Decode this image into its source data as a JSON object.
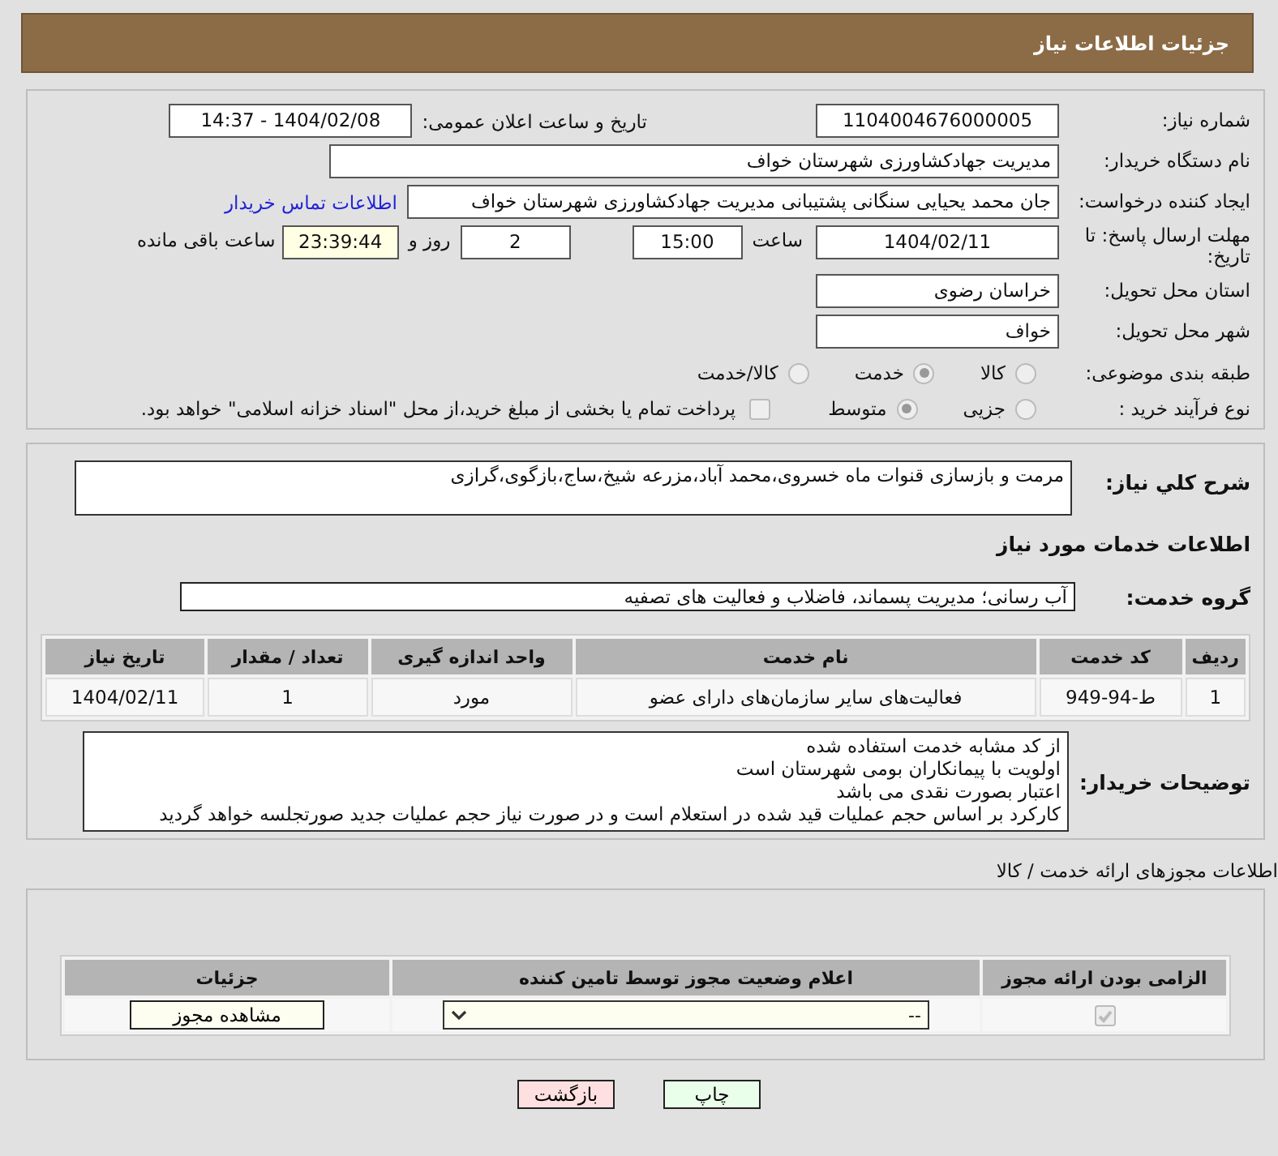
{
  "header": {
    "title": "جزئیات اطلاعات نیاز"
  },
  "details": {
    "need_number": {
      "label": "شماره نیاز:",
      "value": "1104004676000005"
    },
    "announce": {
      "label": "تاریخ و ساعت اعلان عمومی:",
      "value": "1404/02/08 - 14:37"
    },
    "buyer": {
      "label": "نام دستگاه خریدار:",
      "value": "مدیریت جهادکشاورزی شهرستان خواف"
    },
    "creator": {
      "label": "ایجاد کننده درخواست:",
      "value": "جان محمد یحیایی سنگانی پشتیبانی مدیریت جهادکشاورزی شهرستان خواف",
      "link": "اطلاعات تماس خریدار"
    },
    "deadline": {
      "label": "مهلت ارسال پاسخ: تا تاریخ:",
      "date": "1404/02/11",
      "time_label": "ساعت",
      "time": "15:00",
      "days": "2",
      "days_label": "روز و",
      "remaining": "23:39:44",
      "remaining_label": "ساعت باقی مانده"
    },
    "province": {
      "label": "استان محل تحویل:",
      "value": "خراسان رضوی"
    },
    "city": {
      "label": "شهر محل تحویل:",
      "value": "خواف"
    },
    "category": {
      "label": "طبقه بندی موضوعی:",
      "options": [
        {
          "label": "کالا",
          "selected": false
        },
        {
          "label": "خدمت",
          "selected": true
        },
        {
          "label": "کالا/خدمت",
          "selected": false
        }
      ]
    },
    "process": {
      "label": "نوع فرآیند خرید :",
      "options": [
        {
          "label": "جزیی",
          "selected": false
        },
        {
          "label": "متوسط",
          "selected": true
        }
      ],
      "payment": {
        "label": "پرداخت تمام یا بخشی از مبلغ خرید،از محل \"اسناد خزانه اسلامی\" خواهد بود.",
        "checked": false
      }
    }
  },
  "services": {
    "description": {
      "label": "شرح کلي نياز:",
      "value": "مرمت و بازسازی قنوات ماه خسروی،محمد آباد،مزرعه شیخ،ساج،بازگوی،گرازی"
    },
    "heading": "اطلاعات خدمات مورد نیاز",
    "group": {
      "label": "گروه خدمت:",
      "value": "آب رسانی؛ مدیریت پسماند، فاضلاب و فعالیت های تصفیه"
    },
    "table": {
      "columns": [
        "ردیف",
        "کد خدمت",
        "نام خدمت",
        "واحد اندازه گیری",
        "تعداد / مقدار",
        "تاریخ نیاز"
      ],
      "rows": [
        [
          "1",
          "ط-94-949",
          "فعالیت‌های سایر سازمان‌های دارای عضو",
          "مورد",
          "1",
          "1404/02/11"
        ]
      ]
    },
    "notes": {
      "label": "توضیحات خریدار:",
      "lines": [
        "از کد مشابه خدمت استفاده شده",
        "اولویت با پیمانکاران بومی شهرستان است",
        "اعتبار بصورت نقدی می باشد",
        "کارکرد بر اساس حجم عملیات قید شده در استعلام است و در صورت نیاز حجم عملیات جدید صورتجلسه خواهد گردید"
      ]
    }
  },
  "permits": {
    "title": "اطلاعات مجوزهای ارائه خدمت / کالا",
    "columns": [
      "الزامی بودن ارائه مجوز",
      "اعلام وضعیت مجوز توسط تامین کننده",
      "جزئیات"
    ],
    "rows": [
      {
        "required": true,
        "status": "--",
        "button": "مشاهده مجوز"
      }
    ]
  },
  "buttons": [
    {
      "label": "چاپ",
      "kind": "print"
    },
    {
      "label": "بازگشت",
      "kind": "back"
    }
  ]
}
